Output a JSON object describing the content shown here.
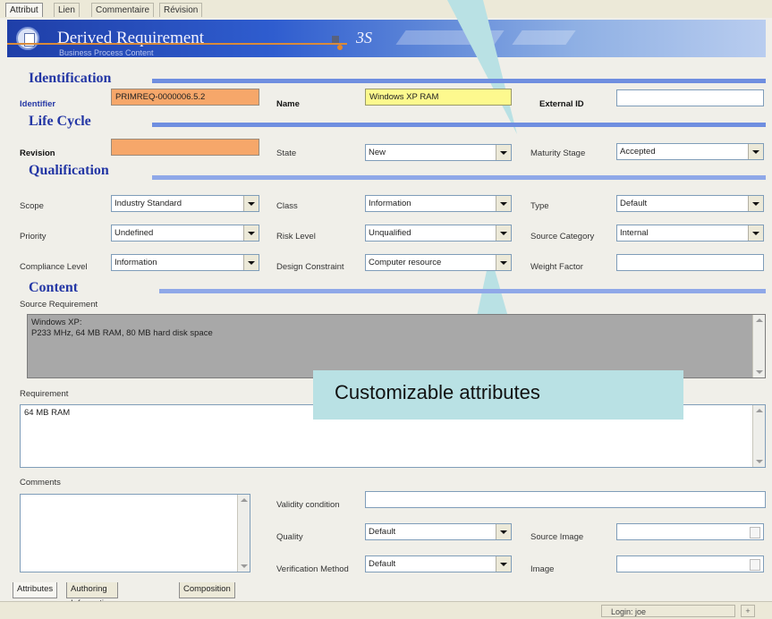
{
  "top_tabs": [
    "Attribut",
    "Lien",
    "Commentaire",
    "Révision"
  ],
  "banner": {
    "title": "Derived Requirement",
    "subtitle": "Business Process Content",
    "logo_text": "3S"
  },
  "sections": {
    "identification": "Identification",
    "life_cycle": "Life Cycle",
    "qualification": "Qualification",
    "content": "Content"
  },
  "identification": {
    "identifier_label": "Identifier",
    "identifier_value": "PRIMREQ-0000006.5.2",
    "name_label": "Name",
    "name_value": "Windows XP RAM",
    "external_id_label": "External ID",
    "external_id_value": ""
  },
  "life_cycle": {
    "revision_label": "Revision",
    "revision_value": "",
    "state_label": "State",
    "state_value": "New",
    "maturity_label": "Maturity Stage",
    "maturity_value": "Accepted"
  },
  "qualification": {
    "scope_label": "Scope",
    "scope_value": "Industry Standard",
    "class_label": "Class",
    "class_value": "Information",
    "type_label": "Type",
    "type_value": "Default",
    "priority_label": "Priority",
    "priority_value": "Undefined",
    "risk_label": "Risk Level",
    "risk_value": "Unqualified",
    "source_cat_label": "Source Category",
    "source_cat_value": "Internal",
    "compliance_label": "Compliance Level",
    "compliance_value": "Information",
    "design_label": "Design Constraint",
    "design_value": "Computer resource",
    "weight_label": "Weight Factor",
    "weight_value": ""
  },
  "content": {
    "source_req_label": "Source Requirement",
    "source_req_line1": "Windows XP:",
    "source_req_line2": "P233 MHz, 64 MB RAM, 80 MB hard disk space",
    "requirement_label": "Requirement",
    "requirement_value": "64 MB RAM",
    "comments_label": "Comments",
    "validity_label": "Validity condition",
    "quality_label": "Quality",
    "quality_value": "Default",
    "source_image_label": "Source Image",
    "verification_label": "Verification Method",
    "verification_value": "Default",
    "image_label": "Image"
  },
  "callout": "Customizable attributes",
  "bottom_tabs": [
    "Attributes",
    "Authoring Information",
    "Composition"
  ],
  "status": {
    "login": "Login: joe"
  }
}
